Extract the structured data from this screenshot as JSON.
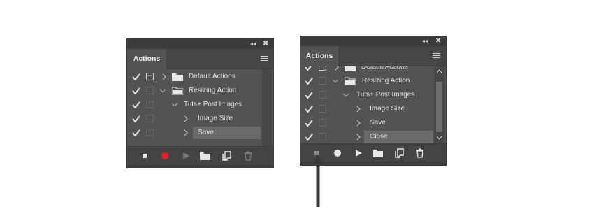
{
  "panel_left": {
    "tab_label": "Actions",
    "rows": [
      {
        "label": "Default Actions",
        "checked": true
      },
      {
        "label": "Resizing Action",
        "checked": true
      },
      {
        "label": "Tuts+ Post Images",
        "checked": true
      },
      {
        "label": "Image Size",
        "checked": true
      },
      {
        "label": "Save",
        "checked": true,
        "selected": true
      }
    ],
    "controls": {
      "collapse": "◂◂",
      "close": "✖"
    }
  },
  "panel_right": {
    "tab_label": "Actions",
    "rows": [
      {
        "label": "Default Actions",
        "checked": true
      },
      {
        "label": "Resizing Action",
        "checked": true
      },
      {
        "label": "Tuts+ Post Images",
        "checked": true
      },
      {
        "label": "Image Size",
        "checked": true
      },
      {
        "label": "Save",
        "checked": true
      },
      {
        "label": "Close",
        "checked": true,
        "selected": true
      }
    ],
    "controls": {
      "collapse": "◂◂",
      "close": "✖"
    }
  },
  "colors": {
    "record_active": "#e8202a",
    "panel_bg": "#535353",
    "selected_row": "#6a6a6a"
  }
}
